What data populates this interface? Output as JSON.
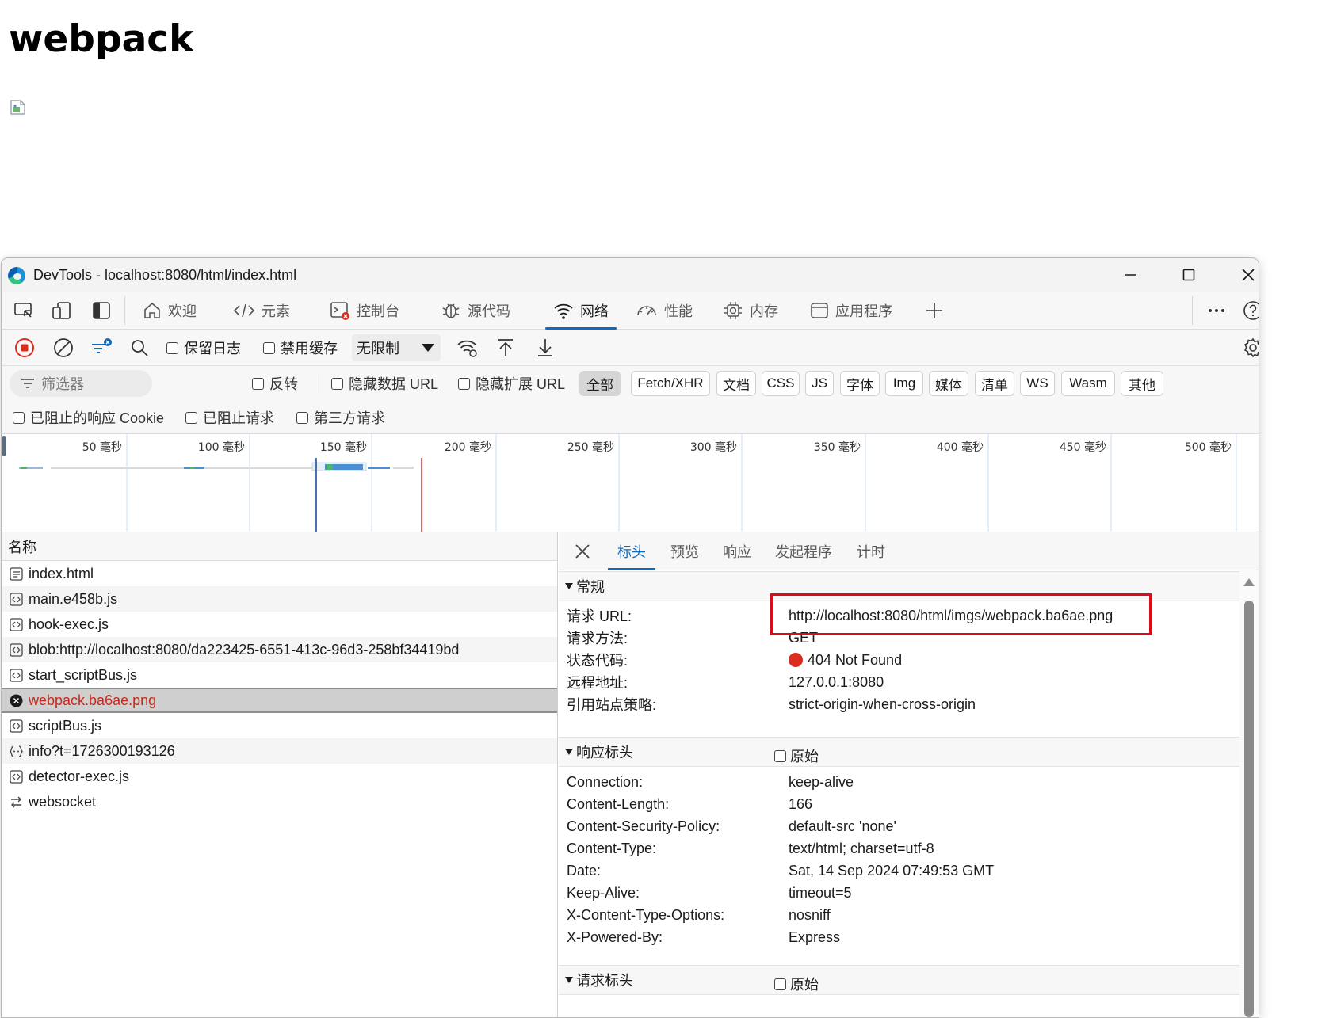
{
  "page": {
    "heading": "webpack"
  },
  "window": {
    "title": "DevTools - localhost:8080/html/index.html"
  },
  "tabs": [
    {
      "label": "欢迎",
      "icon": "home-icon"
    },
    {
      "label": "元素",
      "icon": "code-icon"
    },
    {
      "label": "控制台",
      "icon": "console-icon"
    },
    {
      "label": "源代码",
      "icon": "bug-icon"
    },
    {
      "label": "网络",
      "icon": "wifi-icon"
    },
    {
      "label": "性能",
      "icon": "gauge-icon"
    },
    {
      "label": "内存",
      "icon": "chip-icon"
    },
    {
      "label": "应用程序",
      "icon": "app-icon"
    }
  ],
  "toolbar": {
    "preserve_log": "保留日志",
    "disable_cache": "禁用缓存",
    "throttle": "无限制"
  },
  "filter": {
    "placeholder": "筛选器",
    "invert": "反转",
    "hide_data_url": "隐藏数据 URL",
    "hide_ext_url": "隐藏扩展 URL",
    "types": [
      "全部",
      "Fetch/XHR",
      "文档",
      "CSS",
      "JS",
      "字体",
      "Img",
      "媒体",
      "清单",
      "WS",
      "Wasm",
      "其他"
    ],
    "blocked_cookies": "已阻止的响应 Cookie",
    "blocked_requests": "已阻止请求",
    "third_party": "第三方请求"
  },
  "timeline": {
    "ticks": [
      "50 毫秒",
      "100 毫秒",
      "150 毫秒",
      "200 毫秒",
      "250 毫秒",
      "300 毫秒",
      "350 毫秒",
      "400 毫秒",
      "450 毫秒",
      "500 毫秒"
    ]
  },
  "requests": {
    "header": "名称",
    "items": [
      {
        "name": "index.html",
        "icon": "document-icon"
      },
      {
        "name": "main.e458b.js",
        "icon": "script-icon"
      },
      {
        "name": "hook-exec.js",
        "icon": "script-icon"
      },
      {
        "name": "blob:http://localhost:8080/da223425-6551-413c-96d3-258bf34419bd",
        "icon": "script-icon"
      },
      {
        "name": "start_scriptBus.js",
        "icon": "script-icon"
      },
      {
        "name": "webpack.ba6ae.png",
        "icon": "error-icon",
        "selected": true
      },
      {
        "name": "scriptBus.js",
        "icon": "script-icon"
      },
      {
        "name": "info?t=1726300193126",
        "icon": "fetch-icon"
      },
      {
        "name": "detector-exec.js",
        "icon": "script-icon"
      },
      {
        "name": "websocket",
        "icon": "websocket-icon"
      }
    ]
  },
  "details": {
    "tabs": [
      "标头",
      "预览",
      "响应",
      "发起程序",
      "计时"
    ],
    "general": {
      "title": "常规",
      "rows": [
        {
          "key": "请求 URL:",
          "value": "http://localhost:8080/html/imgs/webpack.ba6ae.png"
        },
        {
          "key": "请求方法:",
          "value": "GET"
        },
        {
          "key": "状态代码:",
          "value": "404 Not Found"
        },
        {
          "key": "远程地址:",
          "value": "127.0.0.1:8080"
        },
        {
          "key": "引用站点策略:",
          "value": "strict-origin-when-cross-origin"
        }
      ]
    },
    "response_headers": {
      "title": "响应标头",
      "raw_label": "原始",
      "rows": [
        {
          "key": "Connection:",
          "value": "keep-alive"
        },
        {
          "key": "Content-Length:",
          "value": "166"
        },
        {
          "key": "Content-Security-Policy:",
          "value": "default-src 'none'"
        },
        {
          "key": "Content-Type:",
          "value": "text/html; charset=utf-8"
        },
        {
          "key": "Date:",
          "value": "Sat, 14 Sep 2024 07:49:53 GMT"
        },
        {
          "key": "Keep-Alive:",
          "value": "timeout=5"
        },
        {
          "key": "X-Content-Type-Options:",
          "value": "nosniff"
        },
        {
          "key": "X-Powered-By:",
          "value": "Express"
        }
      ]
    },
    "request_headers": {
      "title": "请求标头",
      "raw_label": "原始"
    }
  },
  "colors": {
    "accent": "#0f6cbd",
    "error": "#c42b1c",
    "highlight": "#d80d19"
  }
}
